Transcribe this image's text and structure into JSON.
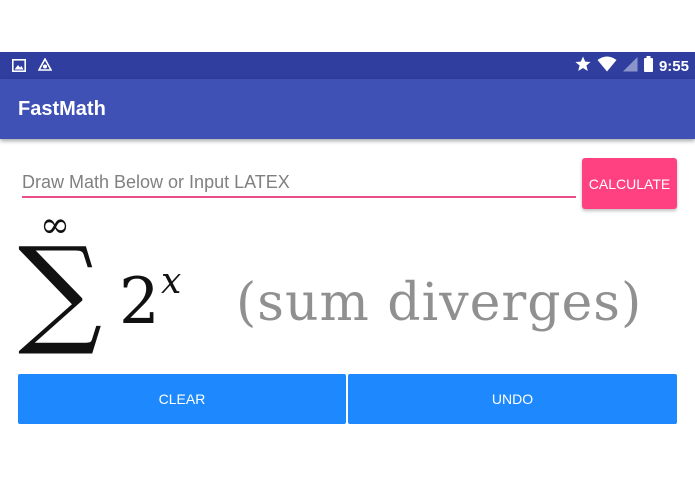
{
  "status_bar": {
    "time": "9:55",
    "icons": [
      "image-icon",
      "app-icon",
      "star-icon",
      "wifi-icon",
      "signal-icon",
      "battery-icon"
    ]
  },
  "app_bar": {
    "title": "FastMath"
  },
  "input": {
    "placeholder": "Draw Math Below or Input LATEX",
    "value": ""
  },
  "buttons": {
    "calculate": "CALCULATE",
    "clear": "CLEAR",
    "undo": "UNDO"
  },
  "math": {
    "sum_symbol": "∑",
    "upper_limit": "∞",
    "base": "2",
    "exponent": "x",
    "result": "(sum diverges)"
  },
  "colors": {
    "status_bar": "#303F9F",
    "app_bar": "#3F51B5",
    "accent": "#FF4081",
    "button_blue": "#1E88FF"
  }
}
